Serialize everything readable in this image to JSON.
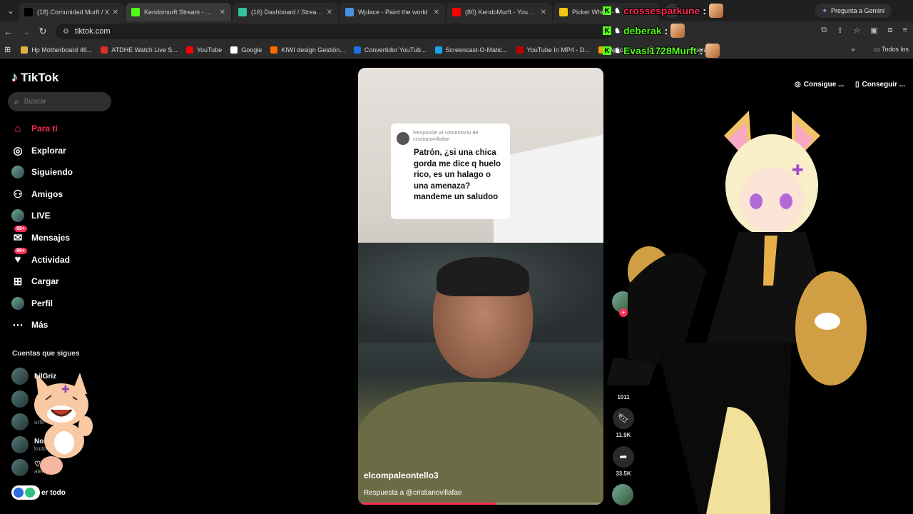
{
  "browser": {
    "tabs": [
      {
        "label": "(18) Comunidad Murft / X",
        "icon": "x-logo-icon",
        "color": "#000000"
      },
      {
        "label": "Kendomurft Stream - Wat",
        "icon": "kick-logo-icon",
        "color": "#53fc18"
      },
      {
        "label": "(16) Dashboard / Streamla",
        "icon": "streamlabs-logo-icon",
        "color": "#31c3a2"
      },
      {
        "label": "Wplace - Paint the world",
        "icon": "wplace-logo-icon",
        "color": "#4a90e2"
      },
      {
        "label": "(80) KendoMurft - YouTub",
        "icon": "youtube-logo-icon",
        "color": "#ff0000"
      },
      {
        "label": "Picker Wheel -",
        "icon": "wheel-logo-icon",
        "color": "#f5c518"
      }
    ],
    "gemini_label": "Pregunta a Gemini",
    "url": "tiktok.com",
    "bookmarks": [
      {
        "label": "Hp Motherboard 46...",
        "color": "#e0b040"
      },
      {
        "label": "ATDHE Watch Live S...",
        "color": "#d93025"
      },
      {
        "label": "YouTube",
        "color": "#ff0000"
      },
      {
        "label": "Google",
        "color": "#ffffff"
      },
      {
        "label": "KIWI design Gestión...",
        "color": "#ff6a00"
      },
      {
        "label": "Convertidor YouTub...",
        "color": "#1a73e8"
      },
      {
        "label": "Screencast-O-Matic...",
        "color": "#1aa3e8"
      },
      {
        "label": "YouTube In MP4 - D...",
        "color": "#c00000"
      },
      {
        "label": "Aplicacion",
        "color": "#e8a400"
      },
      {
        "label": "(2) sv de minecraft...",
        "color": "#888888"
      }
    ],
    "bookmarks_right": "Todos los"
  },
  "tiktok": {
    "logo": "TikTok",
    "search_placeholder": "Buscar",
    "nav": [
      {
        "label": "Para ti",
        "icon": "home-icon",
        "active": true
      },
      {
        "label": "Explorar",
        "icon": "compass-icon"
      },
      {
        "label": "Siguiendo",
        "icon": "following-avatar-icon"
      },
      {
        "label": "Amigos",
        "icon": "friends-icon"
      },
      {
        "label": "LIVE",
        "icon": "live-icon"
      },
      {
        "label": "Mensajes",
        "icon": "messages-icon",
        "badge": "99+"
      },
      {
        "label": "Actividad",
        "icon": "activity-icon",
        "badge": "99+"
      },
      {
        "label": "Cargar",
        "icon": "upload-icon"
      },
      {
        "label": "Perfil",
        "icon": "profile-avatar-icon"
      },
      {
        "label": "Más",
        "icon": "more-icon"
      }
    ],
    "following_title": "Cuentas que sigues",
    "following": [
      {
        "name": "LilGriz",
        "sub": ""
      },
      {
        "name": "",
        "sub": ""
      },
      {
        "name": "",
        "sub": "urfe"
      },
      {
        "name": "Nos",
        "sub": "kudo"
      },
      {
        "name": "♡. ♡.",
        "sub": "aleni_san"
      }
    ],
    "see_all": "er todo",
    "get_buttons": [
      "Consigue ...",
      "Conseguir ..."
    ],
    "video": {
      "comment_header": "Responde al comentario de cristianovillafae",
      "comment_text": "Patrón, ¿si una chica gorda me dice q huelo rico, es un halago o una amenaza? mandeme un saludoo",
      "username": "elcompaleontello3",
      "reply": "Respuesta a @cristianovillafae",
      "progress": 0.56
    },
    "actions": [
      {
        "icon": "comment-icon",
        "count": "1011"
      },
      {
        "icon": "bookmark-icon",
        "count": "11.9K"
      },
      {
        "icon": "share-icon",
        "count": "33.5K"
      }
    ]
  },
  "chat": [
    {
      "user": "crossesparkune",
      "color": "#fe2c55"
    },
    {
      "user": "deberak",
      "color": "#53fc18"
    },
    {
      "user": "Evasl1728Murft",
      "color": "#53fc18"
    }
  ]
}
